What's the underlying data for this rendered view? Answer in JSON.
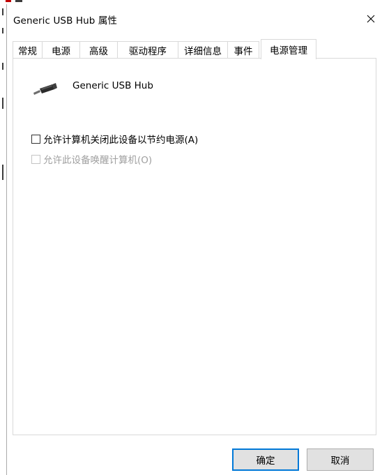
{
  "window": {
    "title": "Generic USB Hub 属性",
    "close_glyph": "×"
  },
  "tabs": [
    {
      "label": "常规",
      "active": false
    },
    {
      "label": "电源",
      "active": false
    },
    {
      "label": "高级",
      "active": false
    },
    {
      "label": "驱动程序",
      "active": false
    },
    {
      "label": "详细信息",
      "active": false
    },
    {
      "label": "事件",
      "active": false
    },
    {
      "label": "电源管理",
      "active": true
    }
  ],
  "device": {
    "icon": "usb-device-icon",
    "name": "Generic USB Hub"
  },
  "options": [
    {
      "label": "允许计算机关闭此设备以节约电源(A)",
      "checked": false,
      "enabled": true
    },
    {
      "label": "允许此设备唤醒计算机(O)",
      "checked": false,
      "enabled": false
    }
  ],
  "buttons": {
    "ok": "确定",
    "cancel": "取消"
  },
  "colors": {
    "accent": "#0078d7",
    "border": "#d9d9d9",
    "disabled_text": "#a0a0a0",
    "button_face": "#e1e1e1"
  }
}
